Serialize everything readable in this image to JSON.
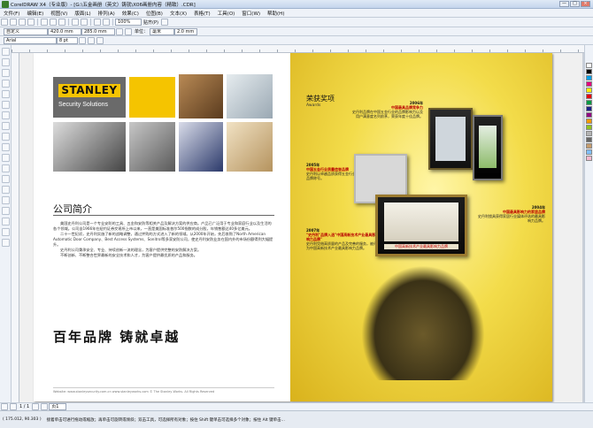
{
  "window": {
    "title": "CorelDRAW X4（专业版）- [G:\\五金画册（英文）铸就\\X06画册内容（精致）.CDR]",
    "min": "—",
    "max": "□",
    "close": "×"
  },
  "menu": [
    "文件(F)",
    "编辑(E)",
    "视图(V)",
    "版面(L)",
    "排列(A)",
    "效果(C)",
    "位图(B)",
    "文本(X)",
    "表格(T)",
    "工具(O)",
    "窗口(W)",
    "帮助(H)"
  ],
  "toolbar1": {
    "zoom": "100%",
    "snap_label": "贴齐(P)"
  },
  "toolbar2": {
    "page_size": "自定义",
    "x": "420.0 mm",
    "y": "285.0 mm",
    "units_label": "单位：",
    "units": "毫米",
    "nudge": "2.0 mm"
  },
  "toolbar3": {
    "font": "Arial",
    "size": "8 pt"
  },
  "left_page": {
    "logo_name": "STANLEY",
    "logo_sub": "Security Solutions",
    "section_title": "公司简介",
    "paragraphs": [
      "美国史丹利公司是一个专业安防的工具、五金和安防等相关产品及解决方案的供应商。产品已广泛用于专业和家庭行业以及生活的各个领域。公司自1966年在纽约证券交易所上市以来，一直是美国标准普尔500指数的成分股，年销售额达40多亿美元。",
      "二十一世纪初，史丹利实施了新的战略调整，通过并购的方式进入了新的领域。从2000年开始，先后收购了North American Automatic Door Company、Best Access Systems、Sonitrol等多家安防公司，使史丹利安防业务在国内外的市场份额得到大幅提升。",
      "史丹利公司秉承安全、专业、持续创新一流的理念，为客户提供完整的安防解决方案。",
      "不断创新、不断整合世界最新的安全技术和人才，为客户提供最优质的产品和服务。"
    ],
    "slogan": "百年品牌  铸就卓越",
    "footer": "Website: www.stanleysecurity.com.cn      www.stanleyworks.com                © The Stanley Works. All Rights Reserved"
  },
  "right_page": {
    "title": "荣获奖项",
    "subtitle": "Awards",
    "awards": [
      {
        "year": "2006年",
        "head": "中国最具品牌竞争力",
        "text": "史丹利品牌在中国五金行业的品牌影响力以及用户满意度名列前茅，荣获年度十佳品牌。"
      },
      {
        "year": "2005年",
        "head": "中国五金行业质量信誉品牌",
        "text": "史丹利以卓越品质获得五金行业质量信誉品牌称号。"
      },
      {
        "year": "2007年",
        "head": "\"史丹利\"品牌入选\"中国高新技术产业最具影响力品牌\"",
        "text": "史丹利凭借高质量的产品及完善的服务，被评为中国高新技术产业最具影响力品牌。"
      },
      {
        "year": "2004年",
        "head": "中国最具影响力的家居品牌",
        "text": "史丹利锁具获得家居行业媒体评选的最具影响力品牌。"
      }
    ],
    "plaque_text": "中国高新技术产业最具影响力品牌"
  },
  "page_nav": {
    "page": "1 / 1",
    "tab": "页1"
  },
  "status": {
    "coords": "( 175.012, 90.303 )",
    "hint": "接着单击可进行拖动或缩放；再单击可旋转或倾斜；双击工具，可选择所有对象；按住 Shift 键单击可选择多个对象；按住 Alt 键单击..."
  }
}
